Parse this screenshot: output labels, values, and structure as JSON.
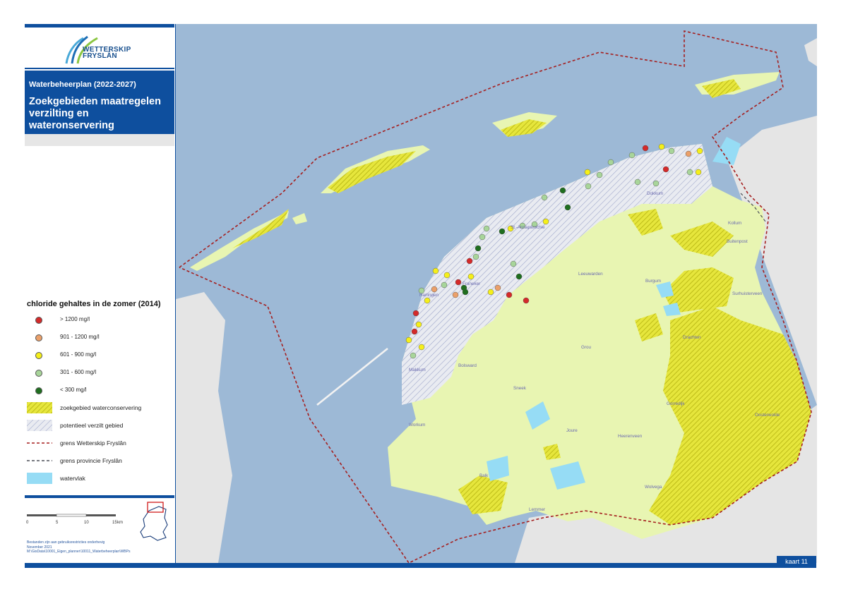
{
  "logo": {
    "line1": "WETTERSKIP",
    "line2": "FRYSLÂN"
  },
  "header": {
    "subtitle": "Waterbeheerplan (2022-2027)",
    "title": "Zoekgebieden maatregelen verzilting en wateronservering"
  },
  "legend": {
    "title": "chloride gehaltes in de zomer (2014)",
    "items": [
      {
        "label": "> 1200 mg/l",
        "color": "#d42a2a"
      },
      {
        "label": "901 - 1200 mg/l",
        "color": "#eba06a"
      },
      {
        "label": "601 - 900 mg/l",
        "color": "#f5ef1a"
      },
      {
        "label": "301 - 600 mg/l",
        "color": "#a8d59a"
      },
      {
        "label": "< 300 mg/l",
        "color": "#1f6e1f"
      }
    ],
    "areas": [
      {
        "label": "zoekgebied waterconservering"
      },
      {
        "label": "potentieel verzilt gebied"
      },
      {
        "label": "grens Wetterskip Fryslân"
      },
      {
        "label": "grens provincie Fryslân"
      },
      {
        "label": "watervlak"
      }
    ]
  },
  "scale": {
    "ticks": [
      "0",
      "5",
      "10",
      "15"
    ],
    "unit": "km"
  },
  "credits": {
    "line1": "Bestanden zijn aan gebruiksrestricties onderhevig",
    "line2": "November 2021",
    "line3": "M:\\GisData\\10001_Eigen_planner\\10011_Waterbeheerplan\\WBPs"
  },
  "map": {
    "kaart_label": "kaart 11",
    "places": [
      "Dokkum",
      "St.-Annaparochie",
      "Kollum",
      "Buitenpost",
      "Leeuwarden",
      "Franeker",
      "Harlingen",
      "Burgum",
      "Surhuisterveen",
      "Drachten",
      "Grou",
      "Bolsward",
      "Makkum",
      "Sneek",
      "Workum",
      "Joure",
      "Gorredijk",
      "Oosterwolde",
      "Heerenveen",
      "Balk",
      "Wolvega",
      "Lemmer"
    ]
  },
  "colors": {
    "sea": "#9db9d6",
    "land_outside": "#e5e5e5",
    "land_frisia": "#e8f5b2",
    "conservering": "#d9de1c",
    "verzilt": "#8c9bd1",
    "water": "#96dcf5",
    "accent": "#0e4f9e",
    "boundary": "#a51f1f"
  }
}
